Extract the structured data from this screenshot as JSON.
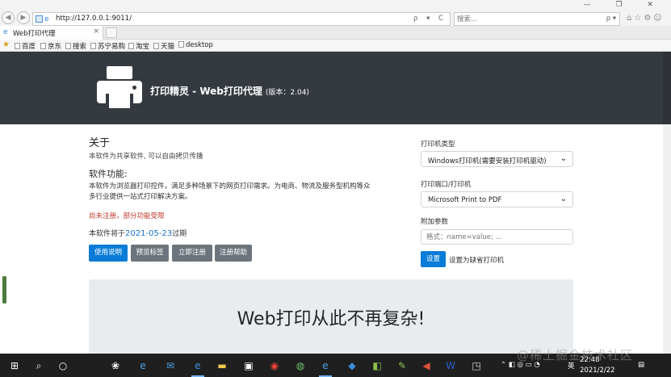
{
  "browser": {
    "url": "http://127.0.0.1:9011/",
    "search_placeholder": "搜索...",
    "address_icons": "ρ ▾ C",
    "search_icon": "ρ ▾",
    "window_controls": "— ❐ ✕",
    "tab": {
      "label": "Web打印代理",
      "close": "×"
    },
    "favorites": [
      "百度",
      "京东",
      "搜索",
      "苏宁易购",
      "淘宝",
      "天猫",
      "desktop"
    ]
  },
  "header": {
    "title": "打印精灵 - Web打印代理",
    "version": "(版本：2.04)"
  },
  "about": {
    "heading": "关于",
    "text": "本软件为共享软件, 可以自由拷贝传播"
  },
  "features": {
    "heading": "软件功能:",
    "text": "本软件为浏览器打印控件，满足多种场景下的网页打印需求。为电商、物流及服务型机构等众多行业提供一站式打印解决方案。"
  },
  "status": {
    "unregistered": "尚未注册，部分功能受限",
    "expire_prefix": "本软件将于",
    "expire_date": "2021-05-23",
    "expire_suffix": "过期"
  },
  "buttons": {
    "manual": "使用说明",
    "preview": "预览标签",
    "register": "立即注册",
    "help": "注册帮助"
  },
  "sidebar": {
    "printer_type_label": "打印机类型",
    "printer_type_value": "Windows打印机(需要安装打印机驱动)",
    "printer_port_label": "打印端口/打印机",
    "printer_port_value": "Microsoft Print to PDF",
    "params_label": "附加参数",
    "params_placeholder": "格式：name=value; ...",
    "set_button": "设置",
    "set_note": "设置为缺省打印机"
  },
  "jumbotron": {
    "text": "Web打印从此不再复杂!"
  },
  "taskbar": {
    "ime": "英",
    "time": "22:48",
    "date": "2021/2/22"
  },
  "watermark": "@稀土掘金技术社区"
}
